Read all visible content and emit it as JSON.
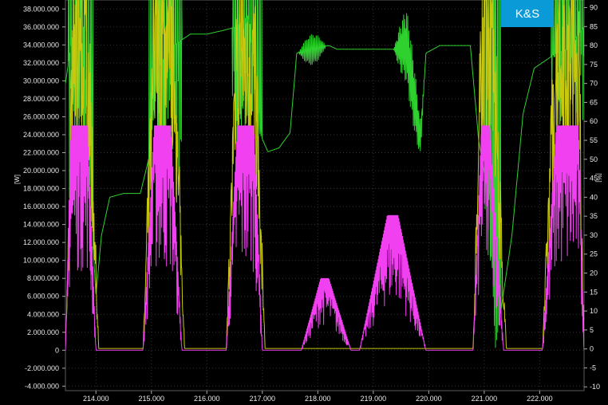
{
  "logo": {
    "text": "K&S",
    "bg": "#0a9ad8"
  },
  "chart_data": {
    "type": "line",
    "background": "#000000",
    "grid": true,
    "xlim": [
      213.45,
      222.8
    ],
    "x_ticks": [
      "214.000",
      "215.000",
      "216.000",
      "217.000",
      "218.000",
      "219.000",
      "220.000",
      "221.000",
      "222.000"
    ],
    "x_tick_values": [
      214,
      215,
      216,
      217,
      218,
      219,
      220,
      221,
      222
    ],
    "y_left": {
      "unit": "[W]",
      "lim": [
        -4500000,
        39000000
      ],
      "ticks": [
        "38.000.000",
        "36.000.000",
        "34.000.000",
        "32.000.000",
        "30.000.000",
        "28.000.000",
        "26.000.000",
        "24.000.000",
        "22.000.000",
        "20.000.000",
        "18.000.000",
        "16.000.000",
        "14.000.000",
        "12.000.000",
        "10.000.000",
        "8.000.000",
        "6.000.000",
        "4.000.000",
        "2.000.000",
        "0",
        "-2.000.000",
        "-4.000.000"
      ],
      "tick_values": [
        38000000,
        36000000,
        34000000,
        32000000,
        30000000,
        28000000,
        26000000,
        24000000,
        22000000,
        20000000,
        18000000,
        16000000,
        14000000,
        12000000,
        10000000,
        8000000,
        6000000,
        4000000,
        2000000,
        0,
        -2000000,
        -4000000
      ]
    },
    "y_right": {
      "unit": "[%]",
      "lim": [
        -11,
        92
      ],
      "ticks": [
        "90",
        "85",
        "80",
        "75",
        "70",
        "65",
        "60",
        "55",
        "50",
        "45",
        "40",
        "35",
        "30",
        "25",
        "20",
        "15",
        "10",
        "5",
        "0",
        "-5",
        "-10"
      ],
      "tick_values": [
        90,
        85,
        80,
        75,
        70,
        65,
        60,
        55,
        50,
        45,
        40,
        35,
        30,
        25,
        20,
        15,
        10,
        5,
        0,
        -5,
        -10
      ]
    },
    "series": [
      {
        "axis": "right",
        "color": "#2fd12f",
        "kind": "percent",
        "points": [
          [
            213.45,
            70
          ],
          [
            213.6,
            85
          ],
          [
            213.75,
            92
          ],
          [
            213.9,
            40
          ],
          [
            214.0,
            14
          ],
          [
            214.1,
            30
          ],
          [
            214.25,
            40
          ],
          [
            214.5,
            41
          ],
          [
            214.8,
            41
          ],
          [
            214.95,
            50
          ],
          [
            215.15,
            75
          ],
          [
            215.4,
            80
          ],
          [
            215.7,
            83
          ],
          [
            216.0,
            83
          ],
          [
            216.3,
            84
          ],
          [
            216.55,
            85
          ],
          [
            216.75,
            88
          ],
          [
            216.95,
            57
          ],
          [
            217.1,
            52
          ],
          [
            217.3,
            53
          ],
          [
            217.5,
            57
          ],
          [
            217.62,
            78
          ],
          [
            218.2,
            80
          ],
          [
            218.35,
            79
          ],
          [
            219.2,
            79
          ],
          [
            219.4,
            79
          ],
          [
            219.6,
            80
          ],
          [
            219.85,
            55
          ],
          [
            219.95,
            78
          ],
          [
            220.2,
            80
          ],
          [
            220.6,
            80
          ],
          [
            220.75,
            80
          ],
          [
            220.9,
            55
          ],
          [
            221.1,
            38
          ],
          [
            221.2,
            0
          ],
          [
            221.5,
            30
          ],
          [
            221.7,
            62
          ],
          [
            221.9,
            74
          ],
          [
            222.1,
            76
          ],
          [
            222.3,
            78
          ],
          [
            222.5,
            79
          ],
          [
            222.8,
            85
          ]
        ],
        "oscillations": [
          {
            "center": 217.9,
            "amp": 4,
            "halfWidth": 0.25,
            "freq": 48
          },
          {
            "center": 219.65,
            "amp": 10,
            "halfWidth": 0.28,
            "freq": 40
          }
        ],
        "spikes": [
          {
            "start": 213.5,
            "end": 213.95,
            "top": 92,
            "bottom": 40
          },
          {
            "start": 214.95,
            "end": 215.55,
            "top": 92,
            "bottom": 45
          },
          {
            "start": 216.45,
            "end": 217.0,
            "top": 92,
            "bottom": 50
          },
          {
            "start": 221.0,
            "end": 221.3,
            "top": 92,
            "bottom": 20
          },
          {
            "start": 222.2,
            "end": 222.8,
            "top": 92,
            "bottom": 60
          }
        ]
      },
      {
        "axis": "left",
        "color": "#c8c810",
        "kind": "power-envelope",
        "bursts": [
          {
            "start": 213.45,
            "peak_start": 213.6,
            "peak_end": 213.85,
            "end": 214.05,
            "peak": 39000000,
            "base": 200000
          },
          {
            "start": 214.85,
            "peak_start": 215.05,
            "peak_end": 215.4,
            "end": 215.6,
            "peak": 39000000,
            "base": 200000
          },
          {
            "start": 216.35,
            "peak_start": 216.55,
            "peak_end": 216.85,
            "end": 217.05,
            "peak": 39000000,
            "base": 200000
          },
          {
            "start": 220.8,
            "peak_start": 220.95,
            "peak_end": 221.15,
            "end": 221.4,
            "peak": 39000000,
            "base": 200000
          },
          {
            "start": 222.05,
            "peak_start": 222.3,
            "peak_end": 222.7,
            "end": 222.8,
            "peak": 39000000,
            "base": 200000
          }
        ]
      },
      {
        "axis": "left",
        "color": "#f040f0",
        "kind": "power",
        "bursts": [
          {
            "start": 213.45,
            "peak_start": 213.55,
            "peak_end": 213.85,
            "end": 214.0,
            "peak": 25000000
          },
          {
            "start": 214.85,
            "peak_start": 215.05,
            "peak_end": 215.35,
            "end": 215.55,
            "peak": 25000000
          },
          {
            "start": 216.35,
            "peak_start": 216.55,
            "peak_end": 216.85,
            "end": 217.0,
            "peak": 25000000
          },
          {
            "start": 217.7,
            "peak_start": 218.05,
            "peak_end": 218.2,
            "end": 218.6,
            "peak": 8000000
          },
          {
            "start": 218.75,
            "peak_start": 219.25,
            "peak_end": 219.45,
            "end": 219.95,
            "peak": 15000000
          },
          {
            "start": 220.8,
            "peak_start": 220.95,
            "peak_end": 221.1,
            "end": 221.35,
            "peak": 25000000
          },
          {
            "start": 222.05,
            "peak_start": 222.3,
            "peak_end": 222.7,
            "end": 222.8,
            "peak": 25000000
          }
        ]
      }
    ]
  }
}
